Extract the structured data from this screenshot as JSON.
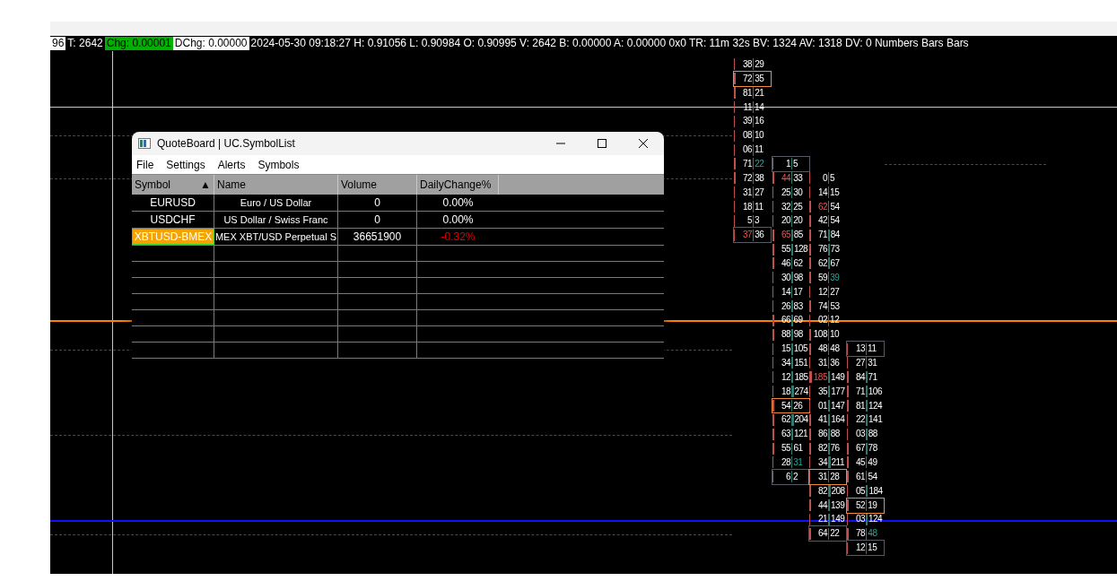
{
  "info_bar": [
    {
      "text": "96",
      "kind": "boxed"
    },
    {
      "text": "T: 2642",
      "kind": "plain"
    },
    {
      "text": "Chg: 0.00001",
      "kind": "up"
    },
    {
      "text": "DChg: 0.00000",
      "kind": "boxed"
    },
    {
      "text": "2024-05-30 09:18:27 H: 0.91056 L: 0.90984 O: 0.90995 V: 2642 B: 0.00000 A: 0.00000 0x0 TR: 11m 32s BV: 1324 AV: 1318 DV: 0 Numbers Bars  Bars",
      "kind": "plain"
    }
  ],
  "quoteboard": {
    "title": "QuoteBoard | UC.SymbolList",
    "menu": [
      "File",
      "Settings",
      "Alerts",
      "Symbols"
    ],
    "columns": [
      {
        "label": "Symbol",
        "sort": "▲"
      },
      {
        "label": "Name"
      },
      {
        "label": "Volume"
      },
      {
        "label": "DailyChange%"
      }
    ],
    "rows": [
      {
        "symbol": "EURUSD",
        "name": "Euro / US Dollar",
        "volume": "0",
        "change": "0.00%",
        "negative": false,
        "selected": false
      },
      {
        "symbol": "USDCHF",
        "name": "US Dollar / Swiss Franc",
        "volume": "0",
        "change": "0.00%",
        "negative": false,
        "selected": false
      },
      {
        "symbol": "XBTUSD-BMEX",
        "name": "MEX XBT/USD Perpetual S",
        "volume": "36651900",
        "change": "-0.32%",
        "negative": true,
        "selected": true
      }
    ]
  },
  "footprint": {
    "columns": [
      {
        "rows": [
          {
            "bid": "38",
            "ask": "29"
          },
          {
            "bid": "72",
            "ask": "35",
            "poc": true
          },
          {
            "bid": "81",
            "ask": "21"
          },
          {
            "bid": "11",
            "ask": "14"
          },
          {
            "bid": "39",
            "ask": "16"
          },
          {
            "bid": "08",
            "ask": "10"
          },
          {
            "bid": "06",
            "ask": "11"
          },
          {
            "bid": "71",
            "ask": "22",
            "ask_imbalance": true
          },
          {
            "bid": "72",
            "ask": "38"
          },
          {
            "bid": "31",
            "ask": "27"
          },
          {
            "bid": "18",
            "ask": "11"
          },
          {
            "bid": "5",
            "ask": "3"
          },
          {
            "bid": "37",
            "ask": "36",
            "bid_imbalance": true,
            "boxed": true
          }
        ]
      },
      {
        "rows": [
          {
            "bid": "1",
            "ask": "5",
            "boxed": true
          },
          {
            "bid": "44",
            "ask": "33",
            "bid_imbalance": true
          },
          {
            "bid": "25",
            "ask": "30"
          },
          {
            "bid": "32",
            "ask": "25"
          },
          {
            "bid": "20",
            "ask": "20"
          },
          {
            "bid": "65",
            "ask": "85",
            "bid_imbalance": true
          },
          {
            "bid": "55",
            "ask": "128"
          },
          {
            "bid": "46",
            "ask": "62"
          },
          {
            "bid": "30",
            "ask": "98"
          },
          {
            "bid": "14",
            "ask": "17"
          },
          {
            "bid": "26",
            "ask": "83"
          },
          {
            "bid": "66",
            "ask": "69"
          },
          {
            "bid": "88",
            "ask": "98"
          },
          {
            "bid": "15",
            "ask": "105"
          },
          {
            "bid": "34",
            "ask": "151"
          },
          {
            "bid": "12",
            "ask": "185"
          },
          {
            "bid": "18",
            "ask": "274"
          },
          {
            "bid": "54",
            "ask": "26",
            "poc": true
          },
          {
            "bid": "62",
            "ask": "204"
          },
          {
            "bid": "63",
            "ask": "121"
          },
          {
            "bid": "55",
            "ask": "61"
          },
          {
            "bid": "28",
            "ask": "31",
            "ask_imbalance": true
          },
          {
            "bid": "6",
            "ask": "2",
            "boxed": true
          }
        ]
      },
      {
        "rows": [
          {
            "bid": "0",
            "ask": "5"
          },
          {
            "bid": "14",
            "ask": "15"
          },
          {
            "bid": "62",
            "ask": "54",
            "bid_imbalance": true
          },
          {
            "bid": "42",
            "ask": "54"
          },
          {
            "bid": "71",
            "ask": "84"
          },
          {
            "bid": "76",
            "ask": "73"
          },
          {
            "bid": "62",
            "ask": "67"
          },
          {
            "bid": "59",
            "ask": "39",
            "ask_imbalance": true
          },
          {
            "bid": "12",
            "ask": "27"
          },
          {
            "bid": "74",
            "ask": "53"
          },
          {
            "bid": "02",
            "ask": "12"
          },
          {
            "bid": "108",
            "ask": "10"
          },
          {
            "bid": "48",
            "ask": "48"
          },
          {
            "bid": "31",
            "ask": "36"
          },
          {
            "bid": "185",
            "ask": "149",
            "bid_imbalance": true
          },
          {
            "bid": "35",
            "ask": "177"
          },
          {
            "bid": "01",
            "ask": "147"
          },
          {
            "bid": "41",
            "ask": "164"
          },
          {
            "bid": "86",
            "ask": "88"
          },
          {
            "bid": "82",
            "ask": "76"
          },
          {
            "bid": "34",
            "ask": "211"
          },
          {
            "bid": "31",
            "ask": "28",
            "poc": true
          },
          {
            "bid": "82",
            "ask": "208"
          },
          {
            "bid": "44",
            "ask": "139"
          },
          {
            "bid": "21",
            "ask": "149"
          },
          {
            "bid": "64",
            "ask": "22",
            "boxed": true
          }
        ]
      },
      {
        "rows": [
          {
            "bid": "13",
            "ask": "11",
            "boxed": true
          },
          {
            "bid": "27",
            "ask": "31"
          },
          {
            "bid": "84",
            "ask": "71"
          },
          {
            "bid": "71",
            "ask": "106"
          },
          {
            "bid": "81",
            "ask": "124"
          },
          {
            "bid": "22",
            "ask": "141"
          },
          {
            "bid": "03",
            "ask": "88"
          },
          {
            "bid": "67",
            "ask": "78"
          },
          {
            "bid": "45",
            "ask": "49"
          },
          {
            "bid": "61",
            "ask": "54"
          },
          {
            "bid": "05",
            "ask": "184"
          },
          {
            "bid": "52",
            "ask": "19",
            "poc": true
          },
          {
            "bid": "03",
            "ask": "124"
          },
          {
            "bid": "78",
            "ask": "48",
            "ask_imbalance": true
          },
          {
            "bid": "12",
            "ask": "15",
            "boxed": true
          }
        ]
      }
    ]
  }
}
